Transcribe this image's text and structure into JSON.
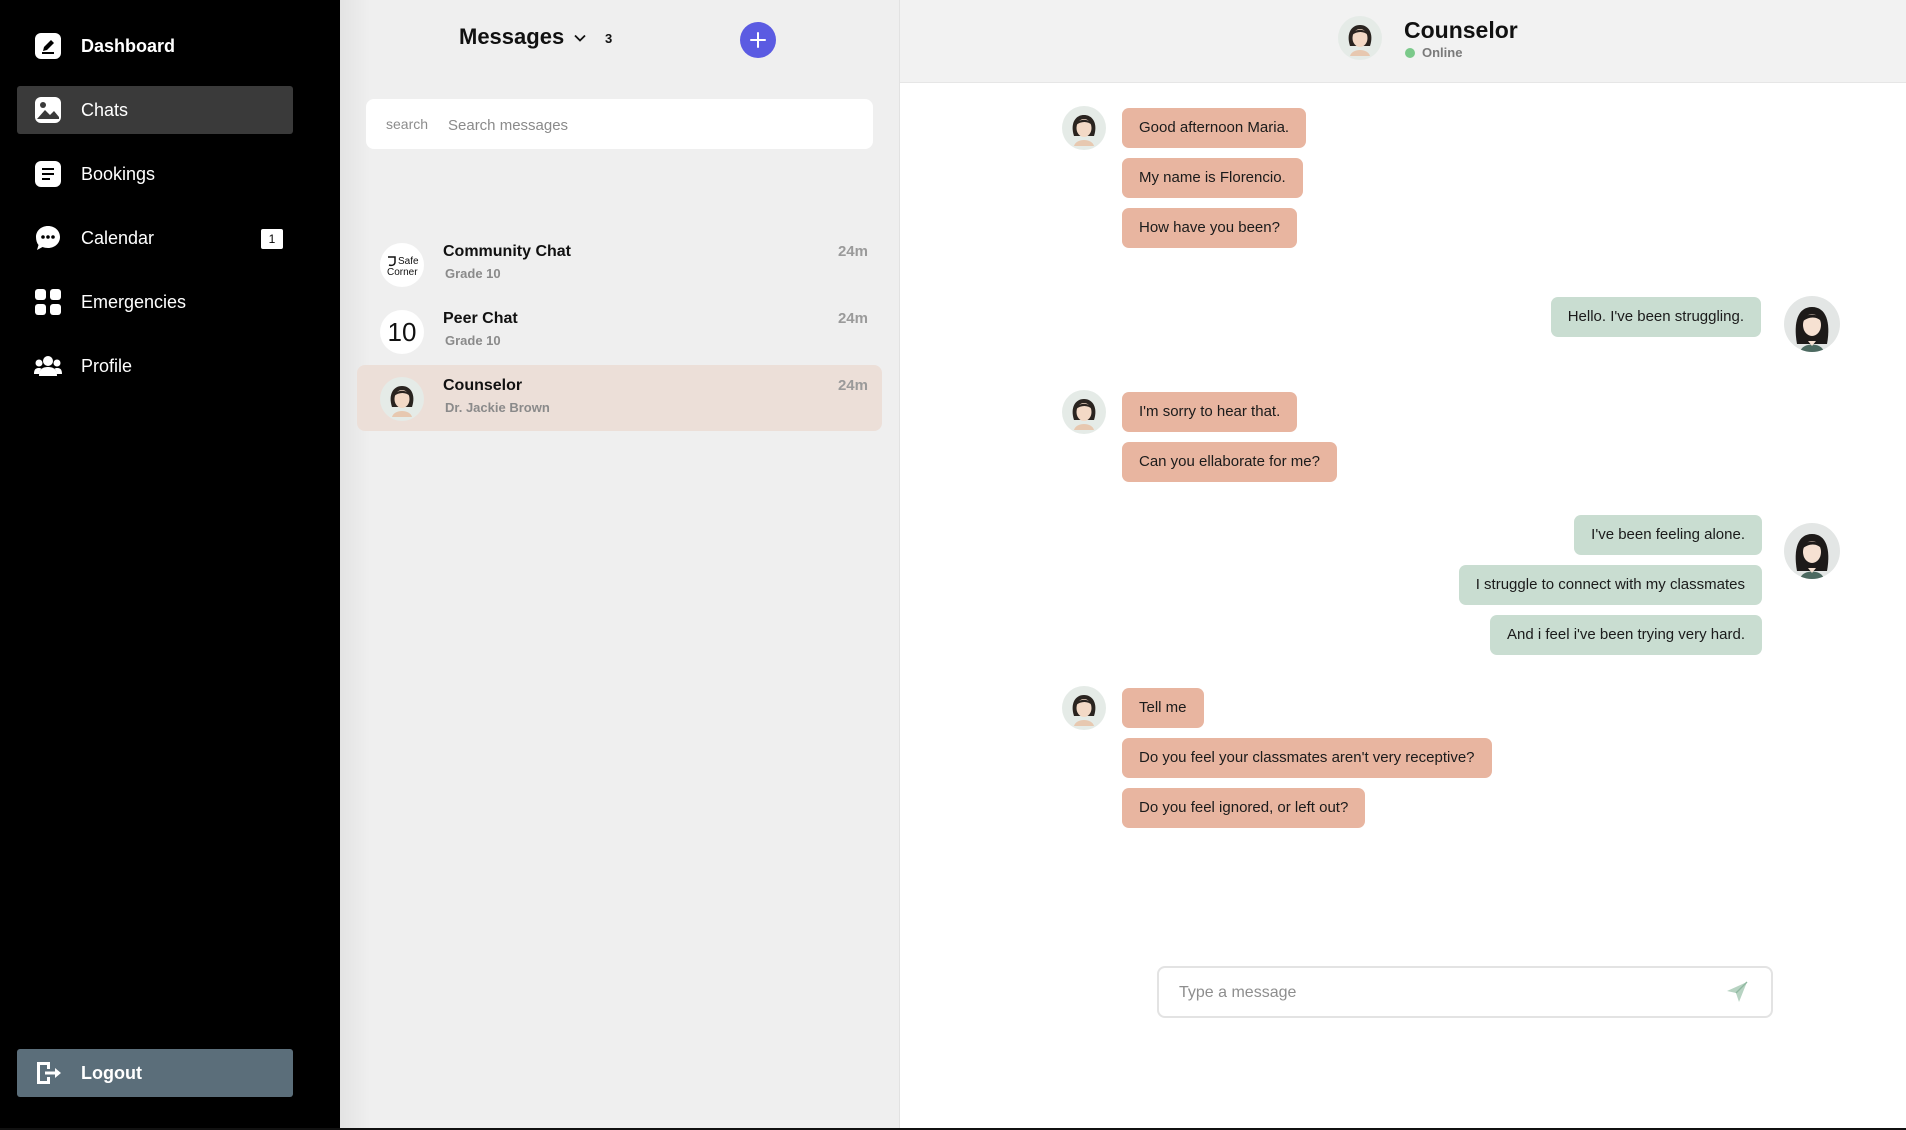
{
  "sidebar": {
    "items": [
      {
        "label": "Dashboard",
        "icon": "edit-icon"
      },
      {
        "label": "Chats",
        "icon": "image-icon"
      },
      {
        "label": "Bookings",
        "icon": "document-icon"
      },
      {
        "label": "Calendar",
        "icon": "chat-bubble-icon",
        "badge": "1"
      },
      {
        "label": "Emergencies",
        "icon": "grid-icon"
      },
      {
        "label": "Profile",
        "icon": "users-icon"
      }
    ],
    "active_item": "Chats",
    "logout_label": "Logout"
  },
  "messages_panel": {
    "title": "Messages",
    "count": "3",
    "search": {
      "icon_label": "search",
      "placeholder": "Search messages"
    },
    "chats": [
      {
        "name": "Community Chat",
        "subtitle": "Grade 10",
        "time": "24m",
        "avatar_logo_text": "Safe Corner"
      },
      {
        "name": "Peer Chat",
        "subtitle": "Grade 10",
        "time": "24m",
        "avatar_text": "10"
      },
      {
        "name": "Counselor",
        "subtitle": "Dr. Jackie Brown",
        "time": "24m",
        "selected": true
      }
    ]
  },
  "conversation": {
    "header": {
      "name": "Counselor",
      "status": "Online"
    },
    "messages": [
      {
        "from": "counselor",
        "text": "Good afternoon Maria."
      },
      {
        "from": "counselor",
        "text": "My name is Florencio."
      },
      {
        "from": "counselor",
        "text": "How have you been?"
      },
      {
        "from": "user",
        "text": "Hello. I've been struggling."
      },
      {
        "from": "counselor",
        "text": "I'm sorry to hear that."
      },
      {
        "from": "counselor",
        "text": "Can you ellaborate for me?"
      },
      {
        "from": "user",
        "text": "I've been feeling alone."
      },
      {
        "from": "user",
        "text": "I struggle to connect with my classmates"
      },
      {
        "from": "user",
        "text": "And i feel i've been trying very hard."
      },
      {
        "from": "counselor",
        "text": "Tell me"
      },
      {
        "from": "counselor",
        "text": "Do you feel your classmates aren't very receptive?"
      },
      {
        "from": "counselor",
        "text": "Do you feel ignored, or left out?"
      }
    ],
    "composer": {
      "placeholder": "Type a message"
    }
  },
  "colors": {
    "sidebar_bg": "#000000",
    "active_nav": "#3a3a3a",
    "logout_bg": "#5b6e7a",
    "accent": "#5b5be2",
    "incoming_bubble": "#e8b5a0",
    "outgoing_bubble": "#c9ddd1",
    "selected_chat": "#ecdfd8",
    "online_dot": "#7bc98a"
  }
}
